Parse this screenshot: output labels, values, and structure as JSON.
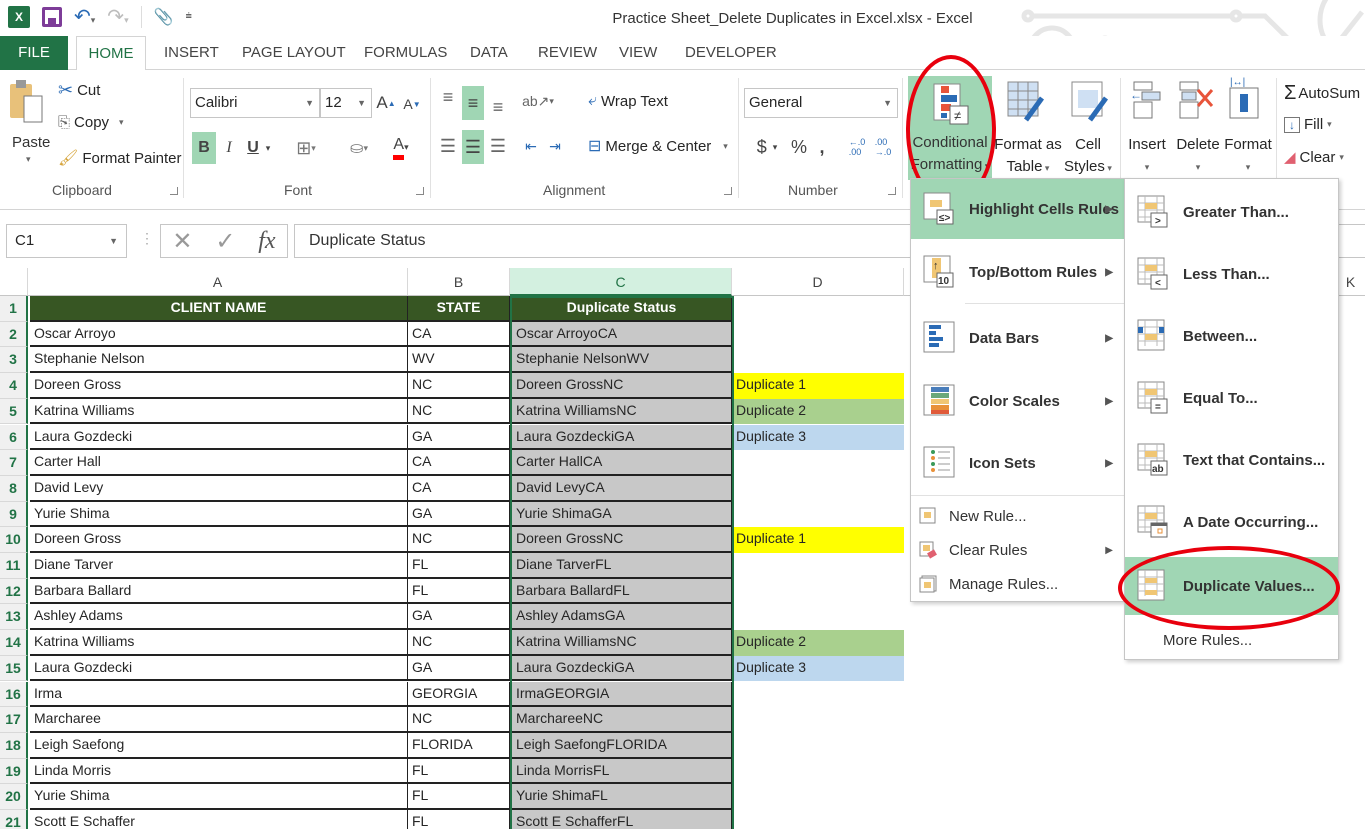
{
  "window": {
    "title": "Practice Sheet_Delete Duplicates in Excel.xlsx - Excel",
    "app_icon": "excel-logo-icon",
    "quick_access": [
      "save-icon",
      "undo-icon",
      "redo-icon",
      "touch-mode-icon",
      "customize-qat-icon"
    ]
  },
  "tabs": [
    {
      "label": "FILE"
    },
    {
      "label": "HOME",
      "active": true
    },
    {
      "label": "INSERT"
    },
    {
      "label": "PAGE LAYOUT"
    },
    {
      "label": "FORMULAS"
    },
    {
      "label": "DATA"
    },
    {
      "label": "REVIEW"
    },
    {
      "label": "VIEW"
    },
    {
      "label": "DEVELOPER"
    }
  ],
  "ribbon": {
    "clipboard": {
      "label": "Clipboard",
      "paste": "Paste",
      "cut": "Cut",
      "copy": "Copy",
      "format_painter": "Format Painter"
    },
    "font": {
      "label": "Font",
      "font_name": "Calibri",
      "font_size": "12",
      "bold": "B",
      "italic": "I",
      "underline": "U",
      "font_color": "#ff0000"
    },
    "alignment": {
      "label": "Alignment",
      "wrap_text": "Wrap Text",
      "merge_center": "Merge & Center"
    },
    "number": {
      "label": "Number",
      "format": "General",
      "currency": "$",
      "percent": "%",
      "comma": ",",
      "inc_decimal": "←.0 .00",
      "dec_decimal": ".00 →.0"
    },
    "styles": {
      "conditional_formatting_line1": "Conditional",
      "conditional_formatting_line2": "Formatting",
      "format_as_table_line1": "Format as",
      "format_as_table_line2": "Table",
      "cell_styles_line1": "Cell",
      "cell_styles_line2": "Styles"
    },
    "cells": {
      "insert": "Insert",
      "delete": "Delete",
      "format": "Format"
    },
    "editing": {
      "autosum": "AutoSum",
      "fill": "Fill",
      "clear": "Clear"
    }
  },
  "formula_bar": {
    "name_box": "C1",
    "cancel": "✕",
    "enter": "✓",
    "fx": "fx",
    "content": "Duplicate Status"
  },
  "grid": {
    "columns": [
      "A",
      "B",
      "C",
      "D",
      "K"
    ],
    "selected_column": "C",
    "headers": [
      "CLIENT NAME",
      "STATE",
      "Duplicate Status"
    ],
    "rows": [
      {
        "n": "1"
      },
      {
        "n": "2",
        "a": "Oscar Arroyo",
        "b": "CA",
        "c": "Oscar ArroyoCA",
        "d": ""
      },
      {
        "n": "3",
        "a": "Stephanie Nelson",
        "b": "WV",
        "c": "Stephanie NelsonWV",
        "d": ""
      },
      {
        "n": "4",
        "a": "Doreen Gross",
        "b": "NC",
        "c": "Doreen GrossNC",
        "d": "Duplicate 1"
      },
      {
        "n": "5",
        "a": "Katrina Williams",
        "b": "NC",
        "c": "Katrina WilliamsNC",
        "d": "Duplicate 2"
      },
      {
        "n": "6",
        "a": "Laura Gozdecki",
        "b": "GA",
        "c": "Laura GozdeckiGA",
        "d": "Duplicate 3"
      },
      {
        "n": "7",
        "a": "Carter Hall",
        "b": "CA",
        "c": "Carter HallCA",
        "d": ""
      },
      {
        "n": "8",
        "a": "David Levy",
        "b": "CA",
        "c": "David LevyCA",
        "d": ""
      },
      {
        "n": "9",
        "a": "Yurie Shima",
        "b": "GA",
        "c": "Yurie ShimaGA",
        "d": ""
      },
      {
        "n": "10",
        "a": "Doreen Gross",
        "b": "NC",
        "c": "Doreen GrossNC",
        "d": "Duplicate 1"
      },
      {
        "n": "11",
        "a": "Diane Tarver",
        "b": "FL",
        "c": "Diane TarverFL",
        "d": ""
      },
      {
        "n": "12",
        "a": "Barbara Ballard",
        "b": "FL",
        "c": "Barbara BallardFL",
        "d": ""
      },
      {
        "n": "13",
        "a": "Ashley Adams",
        "b": "GA",
        "c": "Ashley AdamsGA",
        "d": ""
      },
      {
        "n": "14",
        "a": "Katrina Williams",
        "b": "NC",
        "c": "Katrina WilliamsNC",
        "d": "Duplicate 2"
      },
      {
        "n": "15",
        "a": "Laura Gozdecki",
        "b": "GA",
        "c": "Laura GozdeckiGA",
        "d": "Duplicate 3"
      },
      {
        "n": "16",
        "a": "Irma",
        "b": "GEORGIA",
        "c": "IrmaGEORGIA",
        "d": ""
      },
      {
        "n": "17",
        "a": "Marcharee",
        "b": "NC",
        "c": "MarchareeNC",
        "d": ""
      },
      {
        "n": "18",
        "a": "Leigh Saefong",
        "b": "FLORIDA",
        "c": "Leigh SaefongFLORIDA",
        "d": ""
      },
      {
        "n": "19",
        "a": "Linda Morris",
        "b": "FL",
        "c": "Linda MorrisFL",
        "d": ""
      },
      {
        "n": "20",
        "a": "Yurie Shima",
        "b": "FL",
        "c": "Yurie ShimaFL",
        "d": ""
      },
      {
        "n": "21",
        "a": "Scott E Schaffer",
        "b": "FL",
        "c": "Scott E SchafferFL",
        "d": ""
      }
    ],
    "duplicate_colors": {
      "Duplicate 1": "#ffff00",
      "Duplicate 2": "#a9d08e",
      "Duplicate 3": "#bdd7ee"
    },
    "header_fill": "#375623",
    "c_fill": "#c8c8c8"
  },
  "cf_menu": {
    "items": [
      {
        "label": "Highlight Cells Rules",
        "accel": "H",
        "submenu": true,
        "active": true
      },
      {
        "label": "Top/Bottom Rules",
        "accel": "T",
        "submenu": true
      },
      {
        "label": "Data Bars",
        "accel": "D",
        "submenu": true
      },
      {
        "label": "Color Scales",
        "accel": "S",
        "submenu": true
      },
      {
        "label": "Icon Sets",
        "accel": "I",
        "submenu": true
      }
    ],
    "small_items": [
      {
        "label": "New Rule...",
        "accel": "N"
      },
      {
        "label": "Clear Rules",
        "accel": "C",
        "submenu": true
      },
      {
        "label": "Manage Rules...",
        "accel": "R"
      }
    ]
  },
  "highlight_submenu": {
    "items": [
      {
        "label": "Greater Than...",
        "symbol": ">"
      },
      {
        "label": "Less Than...",
        "symbol": "<"
      },
      {
        "label": "Between...",
        "symbol": ""
      },
      {
        "label": "Equal To...",
        "symbol": "="
      },
      {
        "label": "Text that Contains...",
        "symbol": "ab"
      },
      {
        "label": "A Date Occurring...",
        "symbol": "cal"
      },
      {
        "label": "Duplicate Values...",
        "symbol": "",
        "active": true
      }
    ],
    "more": "More Rules..."
  },
  "annotations": {
    "highlight_color": "#e8000d",
    "targets": [
      "Conditional Formatting",
      "Duplicate Values..."
    ]
  },
  "accent": "#217346",
  "menu_hover": "#a0d6b4"
}
